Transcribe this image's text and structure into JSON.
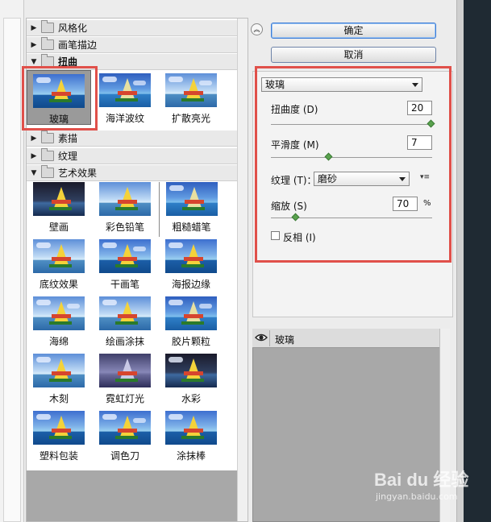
{
  "tree": {
    "groups": [
      {
        "label": "风格化"
      },
      {
        "label": "画笔描边"
      },
      {
        "label": "扭曲",
        "items": [
          "玻璃",
          "海洋波纹",
          "扩散亮光"
        ]
      },
      {
        "label": "素描"
      },
      {
        "label": "纹理"
      },
      {
        "label": "艺术效果",
        "items": [
          "壁画",
          "彩色铅笔",
          "粗糙蜡笔",
          "底纹效果",
          "干画笔",
          "海报边缘",
          "海绵",
          "绘画涂抹",
          "胶片颗粒",
          "木刻",
          "霓虹灯光",
          "水彩",
          "塑料包装",
          "调色刀",
          "涂抹棒"
        ]
      }
    ]
  },
  "buttons": {
    "ok": "确定",
    "cancel": "取消",
    "collapse": "︽"
  },
  "settings": {
    "filter_select": "玻璃",
    "distortion": {
      "label": "扭曲度 (D)",
      "value": "20",
      "level": 1.0
    },
    "smoothness": {
      "label": "平滑度 (M)",
      "value": "7",
      "level": 0.35
    },
    "texture": {
      "label": "纹理 (T)：",
      "value": "磨砂"
    },
    "scaling": {
      "label": "缩放 (S)",
      "value": "70",
      "unit": "%",
      "level": 0.14
    },
    "invert": {
      "label": "反相 (I)",
      "checked": false
    }
  },
  "layers": {
    "name": "玻璃"
  },
  "watermark": {
    "brand": "Bai du 经验",
    "url": "jingyan.baidu.com"
  }
}
